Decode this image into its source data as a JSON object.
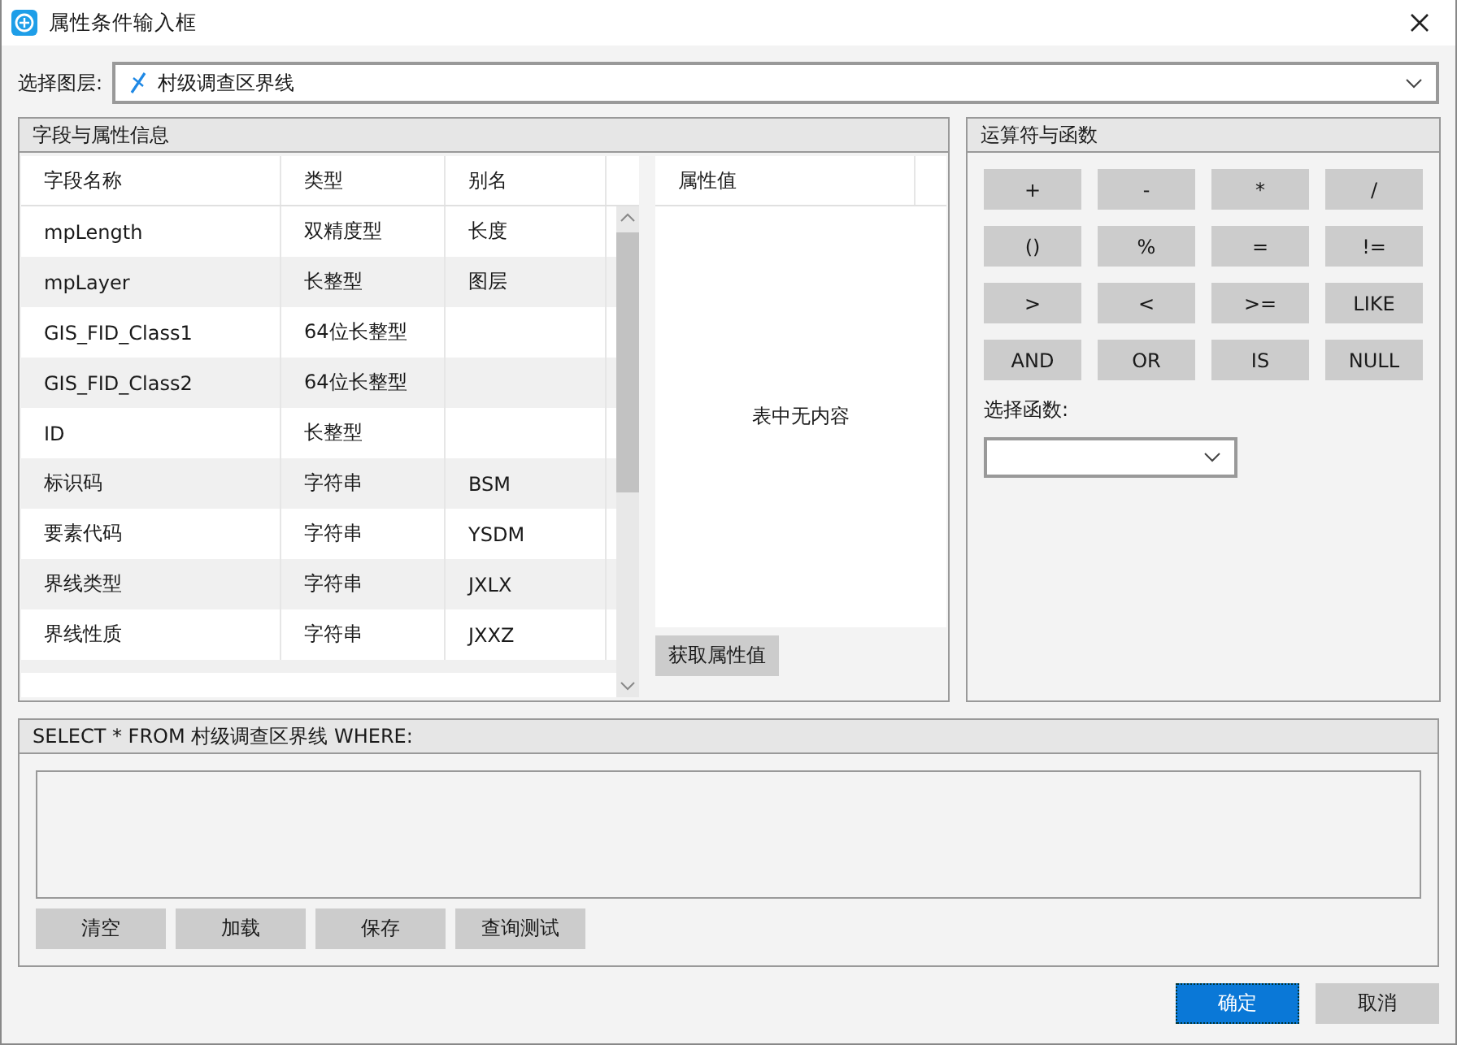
{
  "window": {
    "title": "属性条件输入框"
  },
  "layer": {
    "label": "选择图层:",
    "value": "村级调查区界线"
  },
  "fields_panel": {
    "title": "字段与属性信息",
    "columns": [
      "字段名称",
      "类型",
      "别名"
    ],
    "rows": [
      {
        "name": "mpLength",
        "type": "双精度型",
        "alias": "长度"
      },
      {
        "name": "mpLayer",
        "type": "长整型",
        "alias": "图层"
      },
      {
        "name": "GIS_FID_Class1",
        "type": "64位长整型",
        "alias": ""
      },
      {
        "name": "GIS_FID_Class2",
        "type": "64位长整型",
        "alias": ""
      },
      {
        "name": "ID",
        "type": "长整型",
        "alias": ""
      },
      {
        "name": "标识码",
        "type": "字符串",
        "alias": "BSM"
      },
      {
        "name": "要素代码",
        "type": "字符串",
        "alias": "YSDM"
      },
      {
        "name": "界线类型",
        "type": "字符串",
        "alias": "JXLX"
      },
      {
        "name": "界线性质",
        "type": "字符串",
        "alias": "JXXZ"
      }
    ],
    "values_header": "属性值",
    "values_empty": "表中无内容",
    "get_values_button": "获取属性值"
  },
  "operators_panel": {
    "title": "运算符与函数",
    "operators": [
      "+",
      "-",
      "*",
      "/",
      "()",
      "%",
      "=",
      "!=",
      ">",
      "<",
      ">=",
      "LIKE",
      "AND",
      "OR",
      "IS",
      "NULL"
    ],
    "function_label": "选择函数:"
  },
  "query_panel": {
    "title": "SELECT * FROM 村级调查区界线 WHERE:",
    "buttons": [
      "清空",
      "加载",
      "保存",
      "查询测试"
    ]
  },
  "footer_buttons": [
    {
      "label": "确定",
      "kind": "primary"
    },
    {
      "label": "取消",
      "kind": "normal"
    }
  ]
}
